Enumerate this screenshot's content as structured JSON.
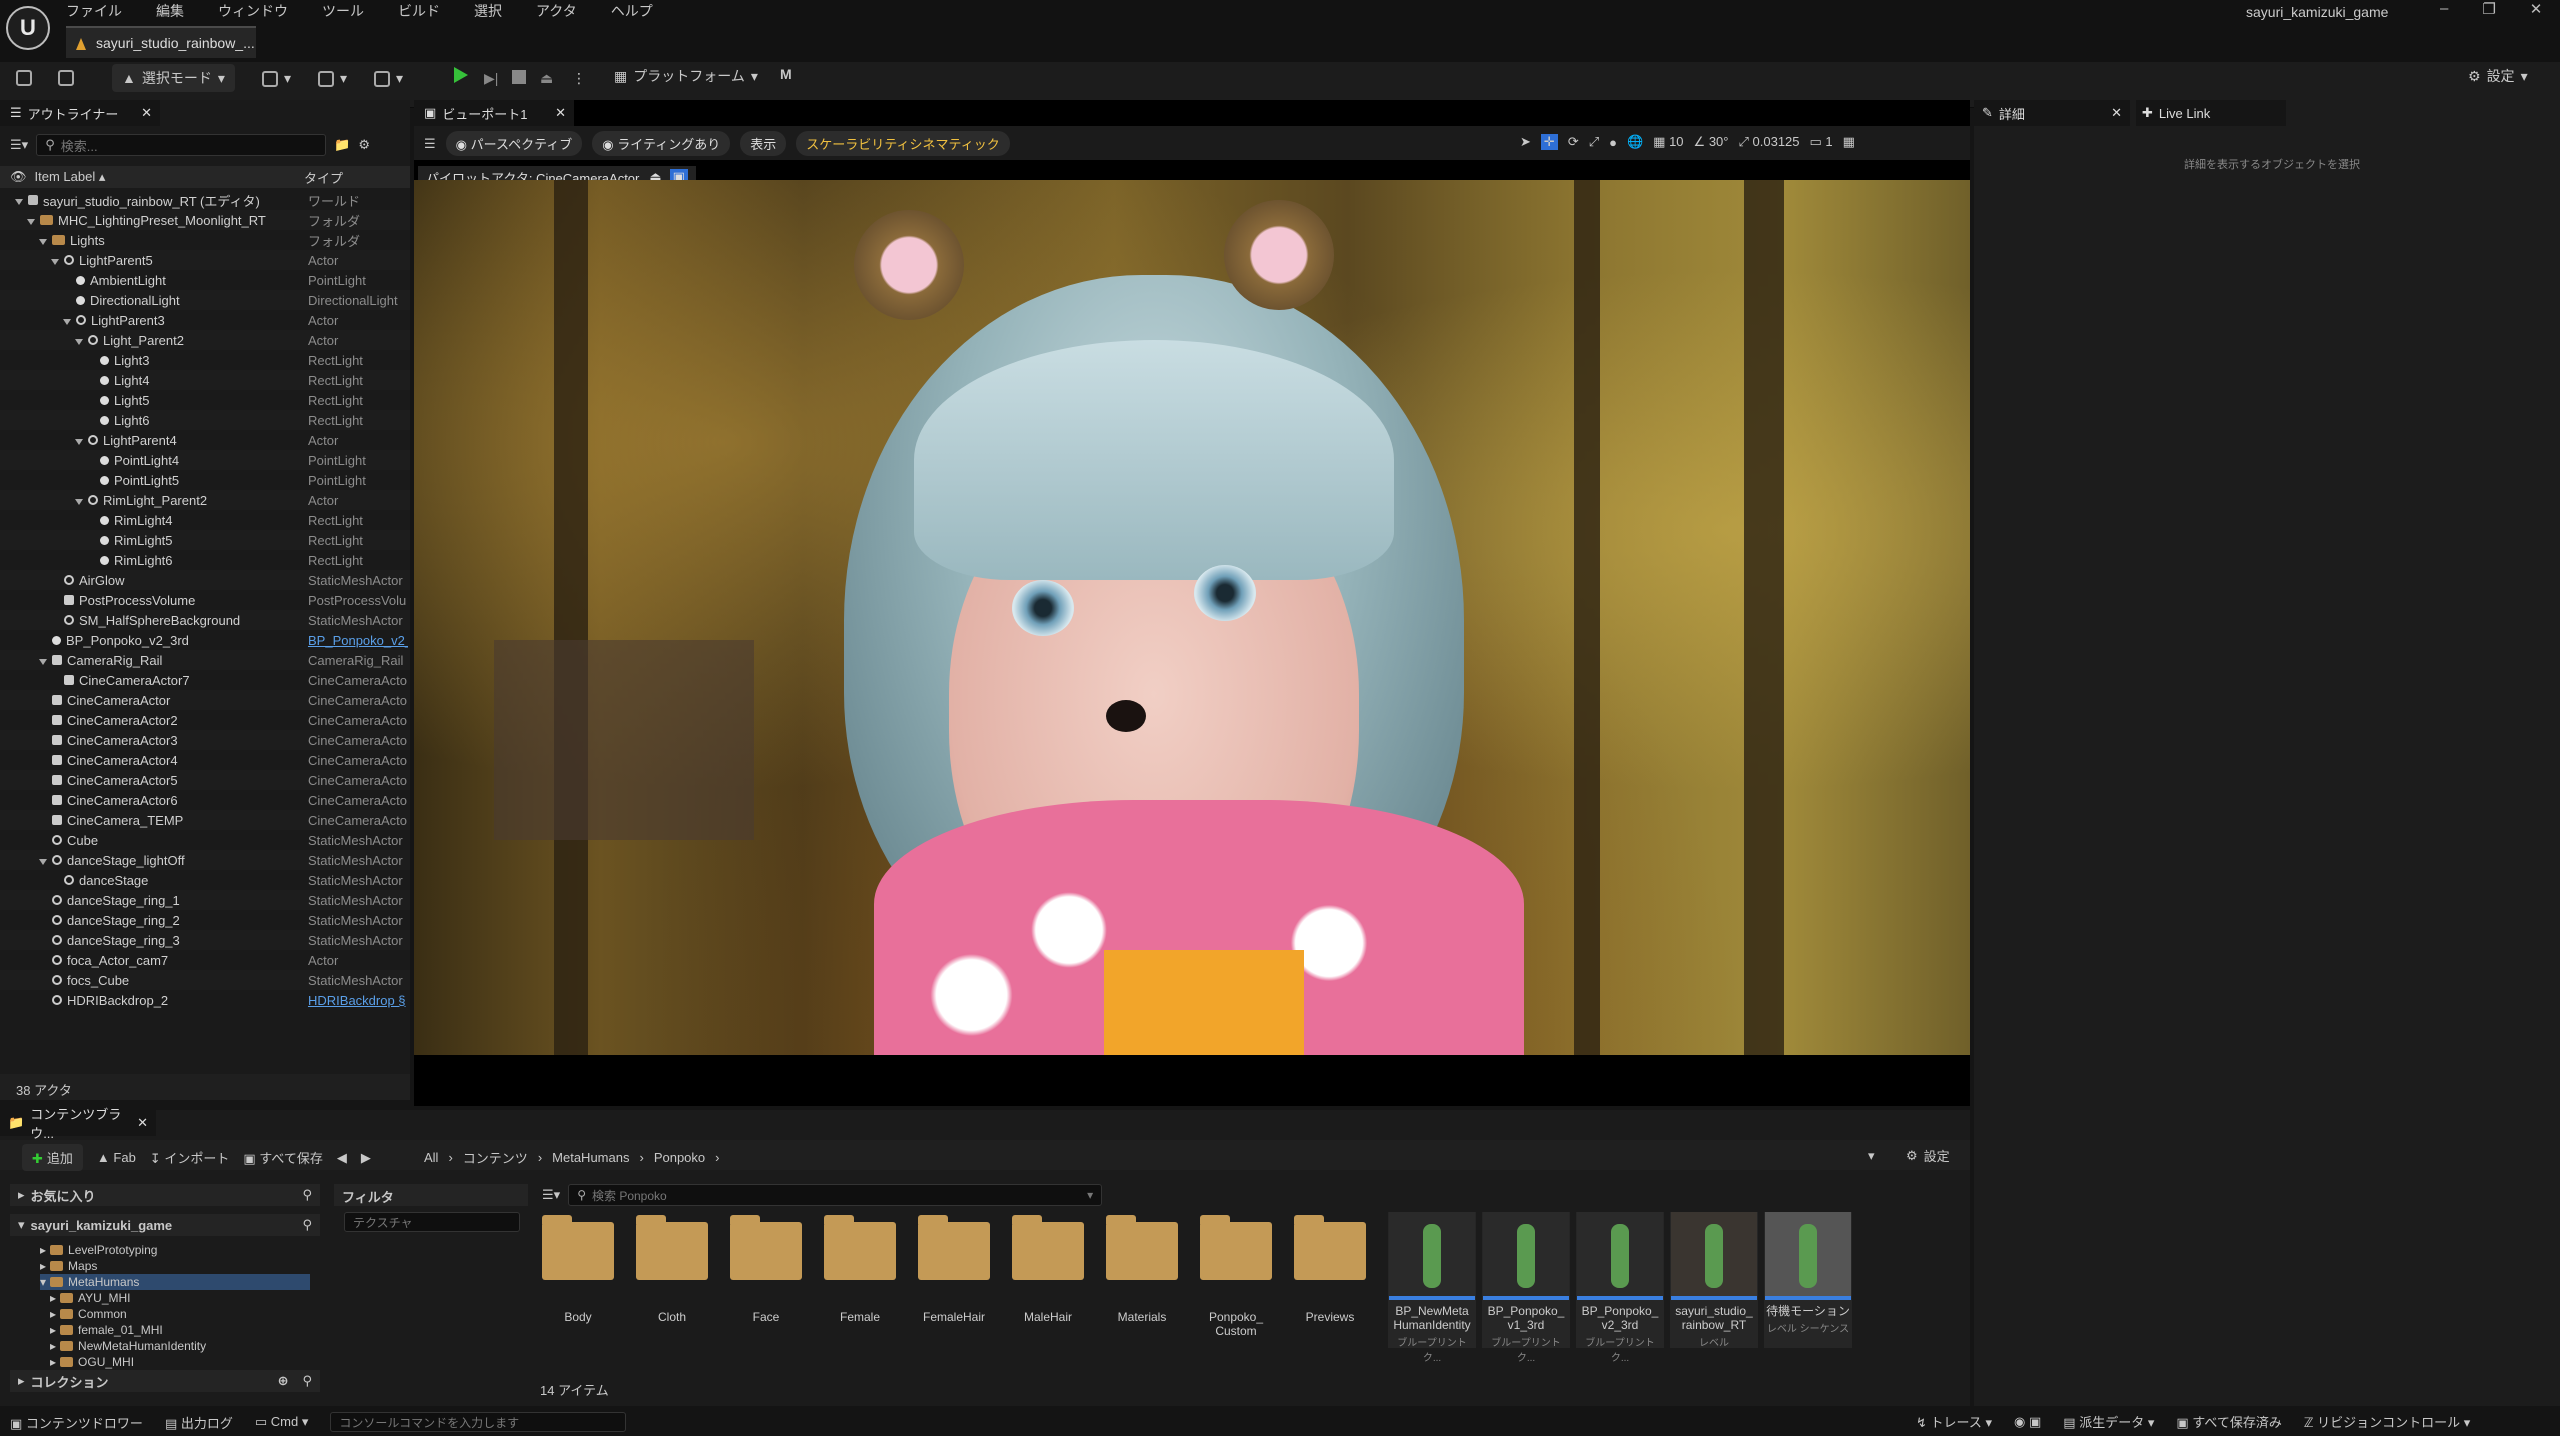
{
  "menu": [
    "ファイル",
    "編集",
    "ウィンドウ",
    "ツール",
    "ビルド",
    "選択",
    "アクタ",
    "ヘルプ"
  ],
  "doc_tab": "sayuri_studio_rainbow_...",
  "account": "sayuri_kamizuki_game",
  "toolbar": {
    "mode": "選択モード",
    "platform": "プラットフォーム",
    "settings": "設定"
  },
  "outliner": {
    "tab": "アウトライナー",
    "search_placeholder": "検索...",
    "col_label": "Item Label ▴",
    "col_type": "タイプ",
    "count": "38 アクタ",
    "rows": [
      {
        "label": "sayuri_studio_rainbow_RT (エディタ)",
        "type": "ワールド",
        "indent": 0,
        "icon": "world",
        "arrow": true
      },
      {
        "label": "MHC_LightingPreset_Moonlight_RT",
        "type": "フォルダ",
        "indent": 1,
        "icon": "folder",
        "arrow": true
      },
      {
        "label": "Lights",
        "type": "フォルダ",
        "indent": 2,
        "icon": "folder",
        "arrow": true
      },
      {
        "label": "LightParent5",
        "type": "Actor",
        "indent": 3,
        "icon": "mesh",
        "arrow": true
      },
      {
        "label": "AmbientLight",
        "type": "PointLight",
        "indent": 4,
        "icon": "light"
      },
      {
        "label": "DirectionalLight",
        "type": "DirectionalLight",
        "indent": 4,
        "icon": "light"
      },
      {
        "label": "LightParent3",
        "type": "Actor",
        "indent": 4,
        "icon": "mesh",
        "arrow": true
      },
      {
        "label": "Light_Parent2",
        "type": "Actor",
        "indent": 5,
        "icon": "mesh",
        "arrow": true
      },
      {
        "label": "Light3",
        "type": "RectLight",
        "indent": 6,
        "icon": "light"
      },
      {
        "label": "Light4",
        "type": "RectLight",
        "indent": 6,
        "icon": "light"
      },
      {
        "label": "Light5",
        "type": "RectLight",
        "indent": 6,
        "icon": "light"
      },
      {
        "label": "Light6",
        "type": "RectLight",
        "indent": 6,
        "icon": "light"
      },
      {
        "label": "LightParent4",
        "type": "Actor",
        "indent": 5,
        "icon": "mesh",
        "arrow": true
      },
      {
        "label": "PointLight4",
        "type": "PointLight",
        "indent": 6,
        "icon": "light"
      },
      {
        "label": "PointLight5",
        "type": "PointLight",
        "indent": 6,
        "icon": "light"
      },
      {
        "label": "RimLight_Parent2",
        "type": "Actor",
        "indent": 5,
        "icon": "mesh",
        "arrow": true
      },
      {
        "label": "RimLight4",
        "type": "RectLight",
        "indent": 6,
        "icon": "light"
      },
      {
        "label": "RimLight5",
        "type": "RectLight",
        "indent": 6,
        "icon": "light"
      },
      {
        "label": "RimLight6",
        "type": "RectLight",
        "indent": 6,
        "icon": "light"
      },
      {
        "label": "AirGlow",
        "type": "StaticMeshActor",
        "indent": 3,
        "icon": "mesh"
      },
      {
        "label": "PostProcessVolume",
        "type": "PostProcessVolu",
        "indent": 3,
        "icon": "cam"
      },
      {
        "label": "SM_HalfSphereBackground",
        "type": "StaticMeshActor",
        "indent": 3,
        "icon": "mesh"
      },
      {
        "label": "BP_Ponpoko_v2_3rd",
        "type": "BP_Ponpoko_v2_",
        "indent": 2,
        "icon": "light",
        "link": true
      },
      {
        "label": "CameraRig_Rail",
        "type": "CameraRig_Rail",
        "indent": 2,
        "icon": "cam",
        "arrow": true
      },
      {
        "label": "CineCameraActor7",
        "type": "CineCameraActo",
        "indent": 3,
        "icon": "cam"
      },
      {
        "label": "CineCameraActor",
        "type": "CineCameraActo",
        "indent": 2,
        "icon": "cam"
      },
      {
        "label": "CineCameraActor2",
        "type": "CineCameraActo",
        "indent": 2,
        "icon": "cam"
      },
      {
        "label": "CineCameraActor3",
        "type": "CineCameraActo",
        "indent": 2,
        "icon": "cam"
      },
      {
        "label": "CineCameraActor4",
        "type": "CineCameraActo",
        "indent": 2,
        "icon": "cam"
      },
      {
        "label": "CineCameraActor5",
        "type": "CineCameraActo",
        "indent": 2,
        "icon": "cam"
      },
      {
        "label": "CineCameraActor6",
        "type": "CineCameraActo",
        "indent": 2,
        "icon": "cam"
      },
      {
        "label": "CineCamera_TEMP",
        "type": "CineCameraActo",
        "indent": 2,
        "icon": "cam"
      },
      {
        "label": "Cube",
        "type": "StaticMeshActor",
        "indent": 2,
        "icon": "mesh"
      },
      {
        "label": "danceStage_lightOff",
        "type": "StaticMeshActor",
        "indent": 2,
        "icon": "mesh",
        "arrow": true
      },
      {
        "label": "danceStage",
        "type": "StaticMeshActor",
        "indent": 3,
        "icon": "mesh"
      },
      {
        "label": "danceStage_ring_1",
        "type": "StaticMeshActor",
        "indent": 2,
        "icon": "mesh"
      },
      {
        "label": "danceStage_ring_2",
        "type": "StaticMeshActor",
        "indent": 2,
        "icon": "mesh"
      },
      {
        "label": "danceStage_ring_3",
        "type": "StaticMeshActor",
        "indent": 2,
        "icon": "mesh"
      },
      {
        "label": "foca_Actor_cam7",
        "type": "Actor",
        "indent": 2,
        "icon": "mesh"
      },
      {
        "label": "focs_Cube",
        "type": "StaticMeshActor",
        "indent": 2,
        "icon": "mesh"
      },
      {
        "label": "HDRIBackdrop_2",
        "type": "HDRIBackdrop §",
        "indent": 2,
        "icon": "mesh",
        "link": true
      }
    ]
  },
  "viewport": {
    "tab": "ビューポート1",
    "perspective": "パースペクティブ",
    "lighting": "ライティングあり",
    "show": "表示",
    "scalability": "スケーラビリティシネマティック",
    "pilot": "パイロットアクタ: CineCameraActor",
    "grid": "10",
    "angle": "30°",
    "scale": "0.03125",
    "cam_speed": "1"
  },
  "details": {
    "tab": "詳細",
    "livelink": "Live Link",
    "empty": "詳細を表示するオブジェクトを選択"
  },
  "content_browser": {
    "tab": "コンテンツブラウ...",
    "add": "追加",
    "fab": "Fab",
    "import": "インポート",
    "save_all": "すべて保存",
    "breadcrumb": [
      "All",
      "コンテンツ",
      "MetaHumans",
      "Ponpoko"
    ],
    "settings": "設定",
    "favorites": "お気に入り",
    "project": "sayuri_kamizuki_game",
    "tree": [
      "LevelPrototyping",
      "Maps",
      "MetaHumans",
      "AYU_MHI",
      "Common",
      "female_01_MHI",
      "NewMetaHumanIdentity",
      "OGU_MHI"
    ],
    "collections": "コレクション",
    "filter": "フィルタ",
    "filter_placeholder": "テクスチャ",
    "search_placeholder": "検索 Ponpoko",
    "folders": [
      "Body",
      "Cloth",
      "Face",
      "Female",
      "FemaleHair",
      "MaleHair",
      "Materials",
      "Ponpoko_ Custom",
      "Previews"
    ],
    "assets": [
      {
        "name": "BP_NewMeta HumanIdentity",
        "sub": "ブループリント ク..."
      },
      {
        "name": "BP_Ponpoko_ v1_3rd",
        "sub": "ブループリント ク..."
      },
      {
        "name": "BP_Ponpoko_ v2_3rd",
        "sub": "ブループリント ク..."
      },
      {
        "name": "sayuri_studio_ rainbow_RT",
        "sub": "レベル"
      },
      {
        "name": "待機モーション",
        "sub": "レベル シーケンス"
      }
    ],
    "item_count": "14 アイテム"
  },
  "status": {
    "drawer": "コンテンツドロワー",
    "output_log": "出力ログ",
    "cmd": "Cmd",
    "console_placeholder": "コンソールコマンドを入力します",
    "trace": "トレース",
    "derived": "派生データ",
    "all_saved": "すべて保存済み",
    "revision": "リビジョンコントロール"
  }
}
